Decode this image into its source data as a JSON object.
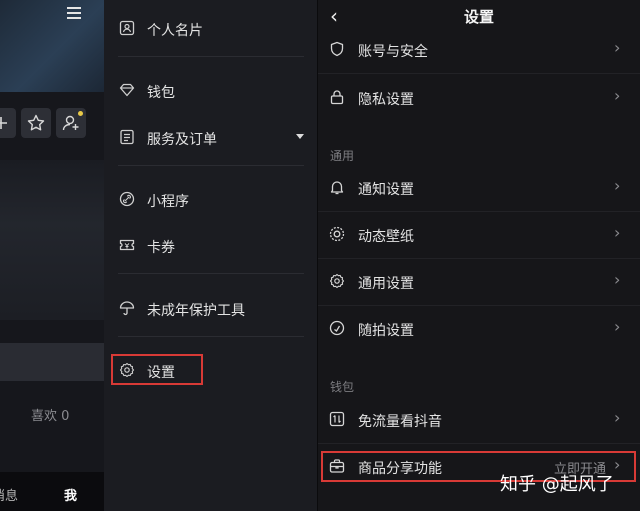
{
  "profile": {
    "likes_label": "喜欢 0",
    "nav": {
      "messages": "消息",
      "me": "我"
    }
  },
  "drawer": {
    "items": [
      {
        "label": "个人名片",
        "icon": "id-card-icon"
      },
      {
        "label": "钱包",
        "icon": "wallet-diamond-icon"
      },
      {
        "label": "服务及订单",
        "icon": "orders-icon"
      },
      {
        "label": "小程序",
        "icon": "mini-program-link-icon"
      },
      {
        "label": "卡券",
        "icon": "coupon-icon"
      },
      {
        "label": "未成年保护工具",
        "icon": "umbrella-icon"
      },
      {
        "label": "设置",
        "icon": "gear-icon"
      }
    ]
  },
  "settings": {
    "back_icon": "back-arrow-icon",
    "title": "设置",
    "top_rows": [
      {
        "label": "账号与安全",
        "icon": "shield-icon"
      },
      {
        "label": "隐私设置",
        "icon": "lock-icon"
      }
    ],
    "general_header": "通用",
    "general_rows": [
      {
        "label": "通知设置",
        "icon": "bell-icon"
      },
      {
        "label": "动态壁纸",
        "icon": "wallpaper-icon"
      },
      {
        "label": "通用设置",
        "icon": "settings-gear-icon"
      },
      {
        "label": "随拍设置",
        "icon": "check-circle-icon"
      }
    ],
    "wallet_header": "钱包",
    "wallet_rows": [
      {
        "label": "免流量看抖音",
        "icon": "data-free-icon"
      },
      {
        "label": "商品分享功能",
        "icon": "briefcase-icon",
        "extra": "立即开通"
      }
    ],
    "chevron": "›"
  },
  "watermark": "知乎 @起风了",
  "colors": {
    "highlight": "#d83a36",
    "badge": "#e9c948"
  }
}
